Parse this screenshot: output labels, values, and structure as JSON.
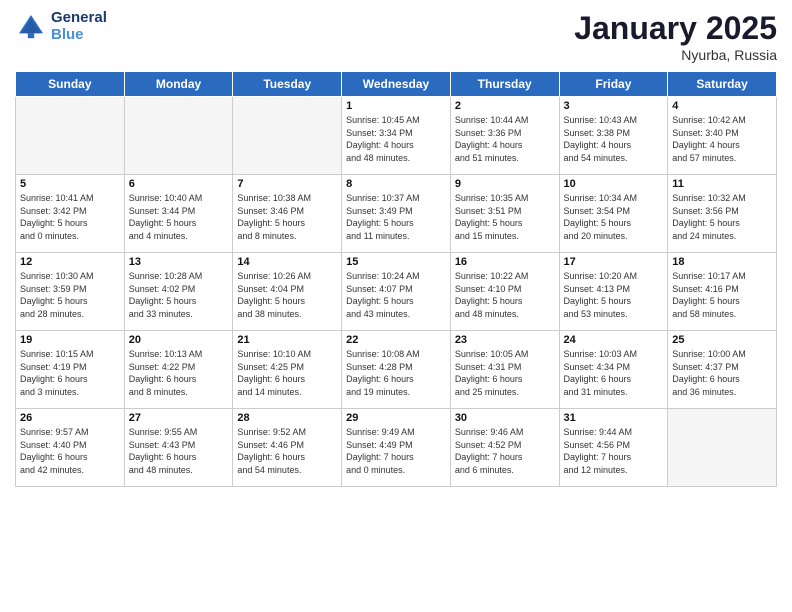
{
  "header": {
    "logo_line1": "General",
    "logo_line2": "Blue",
    "month_title": "January 2025",
    "location": "Nyurba, Russia"
  },
  "weekdays": [
    "Sunday",
    "Monday",
    "Tuesday",
    "Wednesday",
    "Thursday",
    "Friday",
    "Saturday"
  ],
  "weeks": [
    [
      {
        "day": "",
        "info": ""
      },
      {
        "day": "",
        "info": ""
      },
      {
        "day": "",
        "info": ""
      },
      {
        "day": "1",
        "info": "Sunrise: 10:45 AM\nSunset: 3:34 PM\nDaylight: 4 hours\nand 48 minutes."
      },
      {
        "day": "2",
        "info": "Sunrise: 10:44 AM\nSunset: 3:36 PM\nDaylight: 4 hours\nand 51 minutes."
      },
      {
        "day": "3",
        "info": "Sunrise: 10:43 AM\nSunset: 3:38 PM\nDaylight: 4 hours\nand 54 minutes."
      },
      {
        "day": "4",
        "info": "Sunrise: 10:42 AM\nSunset: 3:40 PM\nDaylight: 4 hours\nand 57 minutes."
      }
    ],
    [
      {
        "day": "5",
        "info": "Sunrise: 10:41 AM\nSunset: 3:42 PM\nDaylight: 5 hours\nand 0 minutes."
      },
      {
        "day": "6",
        "info": "Sunrise: 10:40 AM\nSunset: 3:44 PM\nDaylight: 5 hours\nand 4 minutes."
      },
      {
        "day": "7",
        "info": "Sunrise: 10:38 AM\nSunset: 3:46 PM\nDaylight: 5 hours\nand 8 minutes."
      },
      {
        "day": "8",
        "info": "Sunrise: 10:37 AM\nSunset: 3:49 PM\nDaylight: 5 hours\nand 11 minutes."
      },
      {
        "day": "9",
        "info": "Sunrise: 10:35 AM\nSunset: 3:51 PM\nDaylight: 5 hours\nand 15 minutes."
      },
      {
        "day": "10",
        "info": "Sunrise: 10:34 AM\nSunset: 3:54 PM\nDaylight: 5 hours\nand 20 minutes."
      },
      {
        "day": "11",
        "info": "Sunrise: 10:32 AM\nSunset: 3:56 PM\nDaylight: 5 hours\nand 24 minutes."
      }
    ],
    [
      {
        "day": "12",
        "info": "Sunrise: 10:30 AM\nSunset: 3:59 PM\nDaylight: 5 hours\nand 28 minutes."
      },
      {
        "day": "13",
        "info": "Sunrise: 10:28 AM\nSunset: 4:02 PM\nDaylight: 5 hours\nand 33 minutes."
      },
      {
        "day": "14",
        "info": "Sunrise: 10:26 AM\nSunset: 4:04 PM\nDaylight: 5 hours\nand 38 minutes."
      },
      {
        "day": "15",
        "info": "Sunrise: 10:24 AM\nSunset: 4:07 PM\nDaylight: 5 hours\nand 43 minutes."
      },
      {
        "day": "16",
        "info": "Sunrise: 10:22 AM\nSunset: 4:10 PM\nDaylight: 5 hours\nand 48 minutes."
      },
      {
        "day": "17",
        "info": "Sunrise: 10:20 AM\nSunset: 4:13 PM\nDaylight: 5 hours\nand 53 minutes."
      },
      {
        "day": "18",
        "info": "Sunrise: 10:17 AM\nSunset: 4:16 PM\nDaylight: 5 hours\nand 58 minutes."
      }
    ],
    [
      {
        "day": "19",
        "info": "Sunrise: 10:15 AM\nSunset: 4:19 PM\nDaylight: 6 hours\nand 3 minutes."
      },
      {
        "day": "20",
        "info": "Sunrise: 10:13 AM\nSunset: 4:22 PM\nDaylight: 6 hours\nand 8 minutes."
      },
      {
        "day": "21",
        "info": "Sunrise: 10:10 AM\nSunset: 4:25 PM\nDaylight: 6 hours\nand 14 minutes."
      },
      {
        "day": "22",
        "info": "Sunrise: 10:08 AM\nSunset: 4:28 PM\nDaylight: 6 hours\nand 19 minutes."
      },
      {
        "day": "23",
        "info": "Sunrise: 10:05 AM\nSunset: 4:31 PM\nDaylight: 6 hours\nand 25 minutes."
      },
      {
        "day": "24",
        "info": "Sunrise: 10:03 AM\nSunset: 4:34 PM\nDaylight: 6 hours\nand 31 minutes."
      },
      {
        "day": "25",
        "info": "Sunrise: 10:00 AM\nSunset: 4:37 PM\nDaylight: 6 hours\nand 36 minutes."
      }
    ],
    [
      {
        "day": "26",
        "info": "Sunrise: 9:57 AM\nSunset: 4:40 PM\nDaylight: 6 hours\nand 42 minutes."
      },
      {
        "day": "27",
        "info": "Sunrise: 9:55 AM\nSunset: 4:43 PM\nDaylight: 6 hours\nand 48 minutes."
      },
      {
        "day": "28",
        "info": "Sunrise: 9:52 AM\nSunset: 4:46 PM\nDaylight: 6 hours\nand 54 minutes."
      },
      {
        "day": "29",
        "info": "Sunrise: 9:49 AM\nSunset: 4:49 PM\nDaylight: 7 hours\nand 0 minutes."
      },
      {
        "day": "30",
        "info": "Sunrise: 9:46 AM\nSunset: 4:52 PM\nDaylight: 7 hours\nand 6 minutes."
      },
      {
        "day": "31",
        "info": "Sunrise: 9:44 AM\nSunset: 4:56 PM\nDaylight: 7 hours\nand 12 minutes."
      },
      {
        "day": "",
        "info": ""
      }
    ]
  ]
}
